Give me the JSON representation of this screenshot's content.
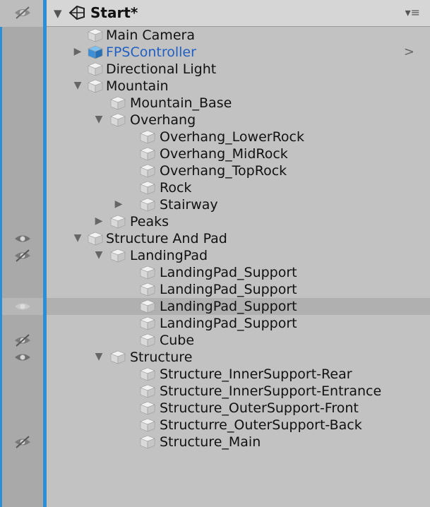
{
  "header": {
    "title": "Start*",
    "menu_icon": "menu-icon"
  },
  "rows": [
    {
      "label": "Main Camera",
      "depth": 1,
      "fold": "",
      "color": "normal"
    },
    {
      "label": "FPSController",
      "depth": 1,
      "fold": "closed",
      "color": "blue",
      "chevron": ">"
    },
    {
      "label": "Directional Light",
      "depth": 1,
      "fold": "",
      "color": "normal"
    },
    {
      "label": "Mountain",
      "depth": 1,
      "fold": "open",
      "color": "normal"
    },
    {
      "label": "Mountain_Base",
      "depth": 2,
      "fold": "",
      "color": "normal"
    },
    {
      "label": "Overhang",
      "depth": 2,
      "fold": "open",
      "color": "normal"
    },
    {
      "label": "Overhang_LowerRock",
      "depth": 3,
      "fold": "",
      "color": "normal"
    },
    {
      "label": "Overhang_MidRock",
      "depth": 3,
      "fold": "",
      "color": "normal"
    },
    {
      "label": "Overhang_TopRock",
      "depth": 3,
      "fold": "",
      "color": "normal"
    },
    {
      "label": "Rock",
      "depth": 3,
      "fold": "",
      "color": "normal"
    },
    {
      "label": "Stairway",
      "depth": 3,
      "fold": "closed",
      "color": "normal"
    },
    {
      "label": "Peaks",
      "depth": 2,
      "fold": "closed",
      "color": "normal"
    },
    {
      "label": "Structure And Pad",
      "depth": 1,
      "fold": "open",
      "color": "normal",
      "gutter": "eye-open"
    },
    {
      "label": "LandingPad",
      "depth": 2,
      "fold": "open",
      "color": "normal",
      "gutter": "eye-closed"
    },
    {
      "label": "LandingPad_Support",
      "depth": 3,
      "fold": "",
      "color": "normal"
    },
    {
      "label": "LandingPad_Support",
      "depth": 3,
      "fold": "",
      "color": "normal"
    },
    {
      "label": "LandingPad_Support",
      "depth": 3,
      "fold": "",
      "color": "normal",
      "gutter": "eye-faint",
      "selected": true
    },
    {
      "label": "LandingPad_Support",
      "depth": 3,
      "fold": "",
      "color": "normal"
    },
    {
      "label": "Cube",
      "depth": 3,
      "fold": "",
      "color": "normal",
      "gutter": "eye-closed"
    },
    {
      "label": "Structure",
      "depth": 2,
      "fold": "open",
      "color": "normal",
      "gutter": "eye-open"
    },
    {
      "label": "Structure_InnerSupport-Rear",
      "depth": 3,
      "fold": "",
      "color": "normal"
    },
    {
      "label": "Structure_InnerSupport-Entrance",
      "depth": 3,
      "fold": "",
      "color": "normal"
    },
    {
      "label": "Structure_OuterSupport-Front",
      "depth": 3,
      "fold": "",
      "color": "normal"
    },
    {
      "label": "Structurre_OuterSupport-Back",
      "depth": 3,
      "fold": "",
      "color": "normal"
    },
    {
      "label": "Structure_Main",
      "depth": 3,
      "fold": "",
      "color": "normal",
      "gutter": "eye-closed"
    }
  ],
  "colors": {
    "accent": "#2a8fd6",
    "background": "#c2c2c2",
    "gutter": "#a9a9a9",
    "selected": "#b0b0b0",
    "blue_label": "#1f5fc4"
  }
}
